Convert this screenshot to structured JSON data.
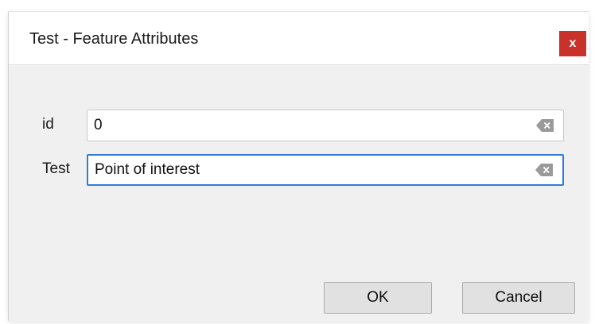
{
  "window": {
    "title": "Test - Feature Attributes",
    "close_label": "x"
  },
  "fields": [
    {
      "label": "id",
      "value": "0"
    },
    {
      "label": "Test",
      "value": "Point of interest"
    }
  ],
  "buttons": {
    "ok_label": "OK",
    "cancel_label": "Cancel"
  },
  "colors": {
    "close_button": "#c9322b",
    "focus_border": "#2f7bd6",
    "client_bg": "#f0f0f0"
  },
  "icons": {
    "clear": "clear-field-icon",
    "close": "close-icon"
  }
}
